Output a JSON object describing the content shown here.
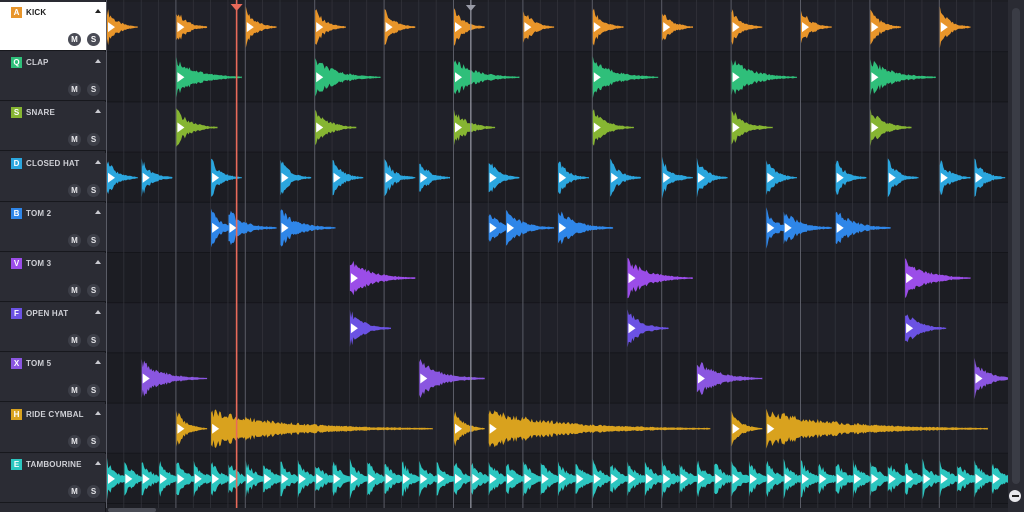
{
  "tracks": [
    {
      "key": "A",
      "name": "KICK",
      "color": "#e8952a",
      "selected": true
    },
    {
      "key": "Q",
      "name": "CLAP",
      "color": "#2fbf7a",
      "selected": false
    },
    {
      "key": "S",
      "name": "SNARE",
      "color": "#86b532",
      "selected": false
    },
    {
      "key": "D",
      "name": "CLOSED HAT",
      "color": "#2ba6de",
      "selected": false
    },
    {
      "key": "B",
      "name": "TOM 2",
      "color": "#2f86e8",
      "selected": false
    },
    {
      "key": "V",
      "name": "TOM 3",
      "color": "#9b4de8",
      "selected": false
    },
    {
      "key": "F",
      "name": "OPEN HAT",
      "color": "#6b52e3",
      "selected": false
    },
    {
      "key": "X",
      "name": "TOM 5",
      "color": "#8a56e0",
      "selected": false
    },
    {
      "key": "H",
      "name": "RIDE CYMBAL",
      "color": "#d9a21e",
      "selected": false
    },
    {
      "key": "E",
      "name": "TAMBOURINE",
      "color": "#2cc6c0",
      "selected": false
    }
  ],
  "buttons": {
    "mute_label": "M",
    "solo_label": "S"
  },
  "playhead_color": "#e86a5a",
  "clips": {
    "KICK": [
      {
        "step": 0,
        "len": 1
      },
      {
        "step": 4,
        "len": 1
      },
      {
        "step": 8,
        "len": 1
      },
      {
        "step": 12,
        "len": 1
      },
      {
        "step": 16,
        "len": 1
      },
      {
        "step": 20,
        "len": 1
      },
      {
        "step": 24,
        "len": 1
      },
      {
        "step": 28,
        "len": 1
      },
      {
        "step": 32,
        "len": 1
      },
      {
        "step": 36,
        "len": 1
      },
      {
        "step": 40,
        "len": 1
      },
      {
        "step": 44,
        "len": 1
      },
      {
        "step": 48,
        "len": 1
      }
    ],
    "CLAP": [
      {
        "step": 4,
        "len": 2
      },
      {
        "step": 12,
        "len": 2
      },
      {
        "step": 20,
        "len": 2
      },
      {
        "step": 28,
        "len": 2
      },
      {
        "step": 36,
        "len": 2
      },
      {
        "step": 44,
        "len": 2
      }
    ],
    "SNARE": [
      {
        "step": 4,
        "len": 1.3
      },
      {
        "step": 12,
        "len": 1.3
      },
      {
        "step": 20,
        "len": 1.3
      },
      {
        "step": 28,
        "len": 1.3
      },
      {
        "step": 36,
        "len": 1.3
      },
      {
        "step": 44,
        "len": 1.3
      }
    ],
    "CLOSED HAT": [
      {
        "step": 0,
        "len": 1
      },
      {
        "step": 2,
        "len": 1
      },
      {
        "step": 6,
        "len": 1
      },
      {
        "step": 10,
        "len": 1
      },
      {
        "step": 13,
        "len": 1
      },
      {
        "step": 16,
        "len": 1
      },
      {
        "step": 18,
        "len": 1
      },
      {
        "step": 22,
        "len": 1
      },
      {
        "step": 26,
        "len": 1
      },
      {
        "step": 29,
        "len": 1
      },
      {
        "step": 32,
        "len": 1
      },
      {
        "step": 34,
        "len": 1
      },
      {
        "step": 38,
        "len": 1
      },
      {
        "step": 42,
        "len": 1
      },
      {
        "step": 45,
        "len": 1
      },
      {
        "step": 48,
        "len": 1
      },
      {
        "step": 50,
        "len": 1
      }
    ],
    "TOM 2": [
      {
        "step": 6,
        "len": 1
      },
      {
        "step": 7,
        "len": 1.5
      },
      {
        "step": 10,
        "len": 1.7
      },
      {
        "step": 22,
        "len": 1
      },
      {
        "step": 23,
        "len": 1.5
      },
      {
        "step": 26,
        "len": 1.7
      },
      {
        "step": 38,
        "len": 1
      },
      {
        "step": 39,
        "len": 1.5
      },
      {
        "step": 42,
        "len": 1.7
      }
    ],
    "TOM 3": [
      {
        "step": 14,
        "len": 2
      },
      {
        "step": 30,
        "len": 2
      },
      {
        "step": 46,
        "len": 2
      }
    ],
    "OPEN HAT": [
      {
        "step": 14,
        "len": 1.3
      },
      {
        "step": 30,
        "len": 1.3
      },
      {
        "step": 46,
        "len": 1.3
      }
    ],
    "TOM 5": [
      {
        "step": 2,
        "len": 2
      },
      {
        "step": 18,
        "len": 2
      },
      {
        "step": 34,
        "len": 2
      },
      {
        "step": 50,
        "len": 1.3
      }
    ],
    "RIDE CYMBAL": [
      {
        "step": 4,
        "len": 1
      },
      {
        "step": 6,
        "len": 6.5
      },
      {
        "step": 20,
        "len": 1
      },
      {
        "step": 22,
        "len": 6.5
      },
      {
        "step": 36,
        "len": 1
      },
      {
        "step": 38,
        "len": 6.5
      }
    ],
    "TAMBOURINE": [
      {
        "step": 0,
        "len": 1
      },
      {
        "step": 1,
        "len": 1
      },
      {
        "step": 2,
        "len": 1
      },
      {
        "step": 3,
        "len": 1
      },
      {
        "step": 4,
        "len": 1
      },
      {
        "step": 5,
        "len": 1
      },
      {
        "step": 6,
        "len": 1
      },
      {
        "step": 7,
        "len": 1
      },
      {
        "step": 8,
        "len": 1
      },
      {
        "step": 9,
        "len": 1
      },
      {
        "step": 10,
        "len": 1
      },
      {
        "step": 11,
        "len": 1
      },
      {
        "step": 12,
        "len": 1
      },
      {
        "step": 13,
        "len": 1
      },
      {
        "step": 14,
        "len": 1
      },
      {
        "step": 15,
        "len": 1
      },
      {
        "step": 16,
        "len": 1
      },
      {
        "step": 17,
        "len": 1
      },
      {
        "step": 18,
        "len": 1
      },
      {
        "step": 19,
        "len": 1
      },
      {
        "step": 20,
        "len": 1
      },
      {
        "step": 21,
        "len": 1
      },
      {
        "step": 22,
        "len": 1
      },
      {
        "step": 23,
        "len": 1
      },
      {
        "step": 24,
        "len": 1
      },
      {
        "step": 25,
        "len": 1
      },
      {
        "step": 26,
        "len": 1
      },
      {
        "step": 27,
        "len": 1
      },
      {
        "step": 28,
        "len": 1
      },
      {
        "step": 29,
        "len": 1
      },
      {
        "step": 30,
        "len": 1
      },
      {
        "step": 31,
        "len": 1
      },
      {
        "step": 32,
        "len": 1
      },
      {
        "step": 33,
        "len": 1
      },
      {
        "step": 34,
        "len": 1
      },
      {
        "step": 35,
        "len": 1
      },
      {
        "step": 36,
        "len": 1
      },
      {
        "step": 37,
        "len": 1
      },
      {
        "step": 38,
        "len": 1
      },
      {
        "step": 39,
        "len": 1
      },
      {
        "step": 40,
        "len": 1
      },
      {
        "step": 41,
        "len": 1
      },
      {
        "step": 42,
        "len": 1
      },
      {
        "step": 43,
        "len": 1
      },
      {
        "step": 44,
        "len": 1
      },
      {
        "step": 45,
        "len": 1
      },
      {
        "step": 46,
        "len": 1
      },
      {
        "step": 47,
        "len": 1
      },
      {
        "step": 48,
        "len": 1
      },
      {
        "step": 49,
        "len": 1
      },
      {
        "step": 50,
        "len": 1
      },
      {
        "step": 51,
        "len": 1
      }
    ]
  }
}
